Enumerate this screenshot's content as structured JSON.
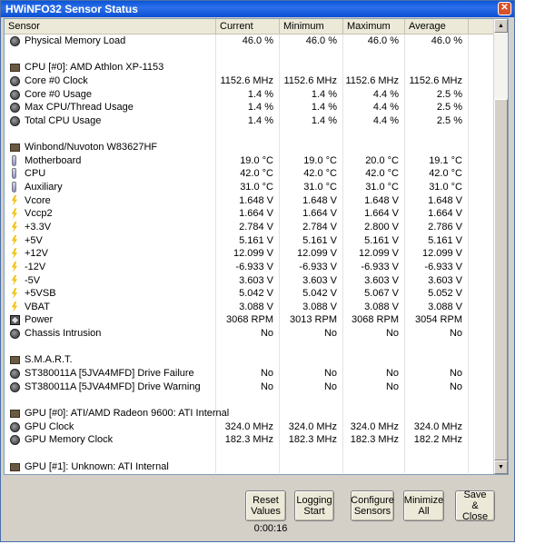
{
  "window": {
    "title": "HWiNFO32 Sensor Status"
  },
  "columns": [
    "Sensor",
    "Current",
    "Minimum",
    "Maximum",
    "Average"
  ],
  "rows": [
    {
      "icon": "sensor",
      "name": "Physical Memory Load",
      "cur": "46.0 %",
      "min": "46.0 %",
      "max": "46.0 %",
      "avg": "46.0 %"
    },
    {
      "icon": "none",
      "name": "",
      "cur": "",
      "min": "",
      "max": "",
      "avg": ""
    },
    {
      "icon": "chip",
      "name": "CPU [#0]: AMD Athlon XP-1153",
      "cur": "",
      "min": "",
      "max": "",
      "avg": ""
    },
    {
      "icon": "sensor",
      "name": "Core #0 Clock",
      "cur": "1152.6 MHz",
      "min": "1152.6 MHz",
      "max": "1152.6 MHz",
      "avg": "1152.6 MHz"
    },
    {
      "icon": "sensor",
      "name": "Core #0 Usage",
      "cur": "1.4 %",
      "min": "1.4 %",
      "max": "4.4 %",
      "avg": "2.5 %"
    },
    {
      "icon": "sensor",
      "name": "Max CPU/Thread Usage",
      "cur": "1.4 %",
      "min": "1.4 %",
      "max": "4.4 %",
      "avg": "2.5 %"
    },
    {
      "icon": "sensor",
      "name": "Total CPU Usage",
      "cur": "1.4 %",
      "min": "1.4 %",
      "max": "4.4 %",
      "avg": "2.5 %"
    },
    {
      "icon": "none",
      "name": "",
      "cur": "",
      "min": "",
      "max": "",
      "avg": ""
    },
    {
      "icon": "chip",
      "name": "Winbond/Nuvoton W83627HF",
      "cur": "",
      "min": "",
      "max": "",
      "avg": ""
    },
    {
      "icon": "temp",
      "name": "Motherboard",
      "cur": "19.0 °C",
      "min": "19.0 °C",
      "max": "20.0 °C",
      "avg": "19.1 °C"
    },
    {
      "icon": "temp",
      "name": "CPU",
      "cur": "42.0 °C",
      "min": "42.0 °C",
      "max": "42.0 °C",
      "avg": "42.0 °C"
    },
    {
      "icon": "temp",
      "name": "Auxiliary",
      "cur": "31.0 °C",
      "min": "31.0 °C",
      "max": "31.0 °C",
      "avg": "31.0 °C"
    },
    {
      "icon": "volt",
      "name": "Vcore",
      "cur": "1.648 V",
      "min": "1.648 V",
      "max": "1.648 V",
      "avg": "1.648 V"
    },
    {
      "icon": "volt",
      "name": "Vccp2",
      "cur": "1.664 V",
      "min": "1.664 V",
      "max": "1.664 V",
      "avg": "1.664 V"
    },
    {
      "icon": "volt",
      "name": "+3.3V",
      "cur": "2.784 V",
      "min": "2.784 V",
      "max": "2.800 V",
      "avg": "2.786 V"
    },
    {
      "icon": "volt",
      "name": "+5V",
      "cur": "5.161 V",
      "min": "5.161 V",
      "max": "5.161 V",
      "avg": "5.161 V"
    },
    {
      "icon": "volt",
      "name": "+12V",
      "cur": "12.099 V",
      "min": "12.099 V",
      "max": "12.099 V",
      "avg": "12.099 V"
    },
    {
      "icon": "volt",
      "name": "-12V",
      "cur": "-6.933 V",
      "min": "-6.933 V",
      "max": "-6.933 V",
      "avg": "-6.933 V"
    },
    {
      "icon": "volt",
      "name": "-5V",
      "cur": "3.603 V",
      "min": "3.603 V",
      "max": "3.603 V",
      "avg": "3.603 V"
    },
    {
      "icon": "volt",
      "name": "+5VSB",
      "cur": "5.042 V",
      "min": "5.042 V",
      "max": "5.067 V",
      "avg": "5.052 V"
    },
    {
      "icon": "volt",
      "name": "VBAT",
      "cur": "3.088 V",
      "min": "3.088 V",
      "max": "3.088 V",
      "avg": "3.088 V"
    },
    {
      "icon": "fan",
      "name": "Power",
      "cur": "3068 RPM",
      "min": "3013 RPM",
      "max": "3068 RPM",
      "avg": "3054 RPM"
    },
    {
      "icon": "sensor",
      "name": "Chassis Intrusion",
      "cur": "No",
      "min": "No",
      "max": "No",
      "avg": "No"
    },
    {
      "icon": "none",
      "name": "",
      "cur": "",
      "min": "",
      "max": "",
      "avg": ""
    },
    {
      "icon": "chip",
      "name": "S.M.A.R.T.",
      "cur": "",
      "min": "",
      "max": "",
      "avg": ""
    },
    {
      "icon": "sensor",
      "name": "ST380011A [5JVA4MFD] Drive Failure",
      "cur": "No",
      "min": "No",
      "max": "No",
      "avg": "No"
    },
    {
      "icon": "sensor",
      "name": "ST380011A [5JVA4MFD] Drive Warning",
      "cur": "No",
      "min": "No",
      "max": "No",
      "avg": "No"
    },
    {
      "icon": "none",
      "name": "",
      "cur": "",
      "min": "",
      "max": "",
      "avg": ""
    },
    {
      "icon": "chip",
      "name": "GPU [#0]: ATI/AMD Radeon 9600: ATI Internal",
      "cur": "",
      "min": "",
      "max": "",
      "avg": ""
    },
    {
      "icon": "sensor",
      "name": "GPU Clock",
      "cur": "324.0 MHz",
      "min": "324.0 MHz",
      "max": "324.0 MHz",
      "avg": "324.0 MHz"
    },
    {
      "icon": "sensor",
      "name": "GPU Memory Clock",
      "cur": "182.3 MHz",
      "min": "182.3 MHz",
      "max": "182.3 MHz",
      "avg": "182.2 MHz"
    },
    {
      "icon": "none",
      "name": "",
      "cur": "",
      "min": "",
      "max": "",
      "avg": ""
    },
    {
      "icon": "chip",
      "name": "GPU [#1]: Unknown: ATI Internal",
      "cur": "",
      "min": "",
      "max": "",
      "avg": ""
    }
  ],
  "buttons": {
    "reset": [
      "Reset",
      "Values"
    ],
    "logging": [
      "Logging",
      "Start"
    ],
    "configure": [
      "Configure",
      "Sensors"
    ],
    "minimize": [
      "Minimize",
      "All"
    ],
    "save_close": [
      "Save",
      "& Close"
    ]
  },
  "timer": "0:00:16"
}
